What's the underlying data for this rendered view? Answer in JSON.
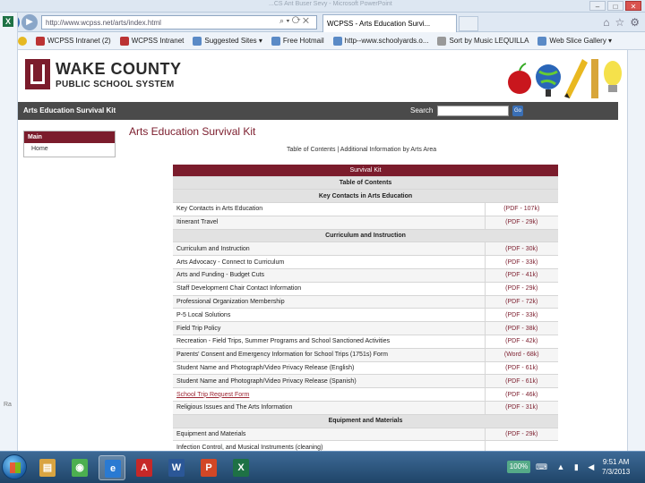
{
  "browser": {
    "title_faded": "...CS Ant Buser Sevy - Microsoft PowerPoint",
    "address": "http://www.wcpss.net/arts/index.html",
    "tab_title": "WCPSS - Arts Education Survi...",
    "favorites": [
      {
        "label": "WCPSS Intranet (2)",
        "icon": "red"
      },
      {
        "label": "WCPSS Intranet",
        "icon": "red"
      },
      {
        "label": "Suggested Sites ▾",
        "icon": "blue"
      },
      {
        "label": "Free Hotmail",
        "icon": "blue"
      },
      {
        "label": "http--www.schoolyards.o...",
        "icon": "blue"
      },
      {
        "label": "Sort by Music LEQUILLA",
        "icon": "gray"
      },
      {
        "label": "Web Slice Gallery ▾",
        "icon": "blue"
      }
    ]
  },
  "site": {
    "logo_line1": "WAKE COUNTY",
    "logo_line2": "PUBLIC SCHOOL SYSTEM",
    "band_title": "Arts Education Survival Kit",
    "search_label": "Search",
    "go_label": "Go",
    "menu_header": "Main",
    "menu_item": "Home",
    "page_title": "Arts Education Survival Kit",
    "links_text": "Table of Contents | Additional Information by Arts Area"
  },
  "table": {
    "caption": "Survival Kit",
    "toc": "Table of Contents",
    "rows": [
      {
        "type": "section",
        "label": "Key Contacts in Arts Education"
      },
      {
        "type": "row",
        "label": "Key Contacts in Arts Education",
        "pdf": "(PDF - 107k)"
      },
      {
        "type": "row",
        "label": "Itinerant Travel",
        "pdf": "(PDF - 29k)"
      },
      {
        "type": "section",
        "label": "Curriculum and Instruction"
      },
      {
        "type": "row",
        "label": "Curriculum and Instruction",
        "pdf": "(PDF - 30k)"
      },
      {
        "type": "row",
        "label": "Arts Advocacy - Connect to Curriculum",
        "pdf": "(PDF - 33k)"
      },
      {
        "type": "row",
        "label": "Arts and Funding - Budget Cuts",
        "pdf": "(PDF - 41k)"
      },
      {
        "type": "row",
        "label": "Staff Development Chair Contact Information",
        "pdf": "(PDF - 29k)"
      },
      {
        "type": "row",
        "label": "Professional Organization Membership",
        "pdf": "(PDF - 72k)"
      },
      {
        "type": "row",
        "label": "P-5 Local Solutions",
        "pdf": "(PDF - 33k)"
      },
      {
        "type": "row",
        "label": "Field Trip Policy",
        "pdf": "(PDF - 38k)"
      },
      {
        "type": "row",
        "label": "Recreation - Field Trips, Summer Programs and School Sanctioned Activities",
        "pdf": "(PDF - 42k)"
      },
      {
        "type": "row",
        "label": "Parents' Consent and Emergency Information for School Trips (1751s) Form",
        "pdf": "(Word - 68k)"
      },
      {
        "type": "row",
        "label": "Student Name and Photograph/Video Privacy Release (English)",
        "pdf": "(PDF - 61k)"
      },
      {
        "type": "row",
        "label": "Student Name and Photograph/Video Privacy Release (Spanish)",
        "pdf": "(PDF - 61k)"
      },
      {
        "type": "row",
        "label": "School Trip Request Form",
        "pdf": "(PDF - 46k)",
        "linked": true
      },
      {
        "type": "row",
        "label": "Religious Issues and The Arts Information",
        "pdf": "(PDF - 31k)"
      },
      {
        "type": "section",
        "label": "Equipment and Materials"
      },
      {
        "type": "row",
        "label": "Equipment and Materials",
        "pdf": "(PDF - 29k)"
      },
      {
        "type": "row",
        "label": "Infection Control, and Musical Instruments (cleaning)",
        "pdf": ""
      }
    ]
  },
  "taskbar": {
    "zoom": "100%",
    "time": "9:51 AM",
    "date": "7/3/2013",
    "apps": [
      {
        "name": "explorer",
        "glyph": "▤",
        "color": "#d9a441"
      },
      {
        "name": "chrome",
        "glyph": "◉",
        "color": "#4caf50"
      },
      {
        "name": "ie",
        "glyph": "e",
        "color": "#2a7ad2"
      },
      {
        "name": "acrobat",
        "glyph": "A",
        "color": "#c62828"
      },
      {
        "name": "word",
        "glyph": "W",
        "color": "#2b5797"
      },
      {
        "name": "powerpoint",
        "glyph": "P",
        "color": "#d24726"
      },
      {
        "name": "excel",
        "glyph": "X",
        "color": "#1e7145"
      }
    ]
  }
}
